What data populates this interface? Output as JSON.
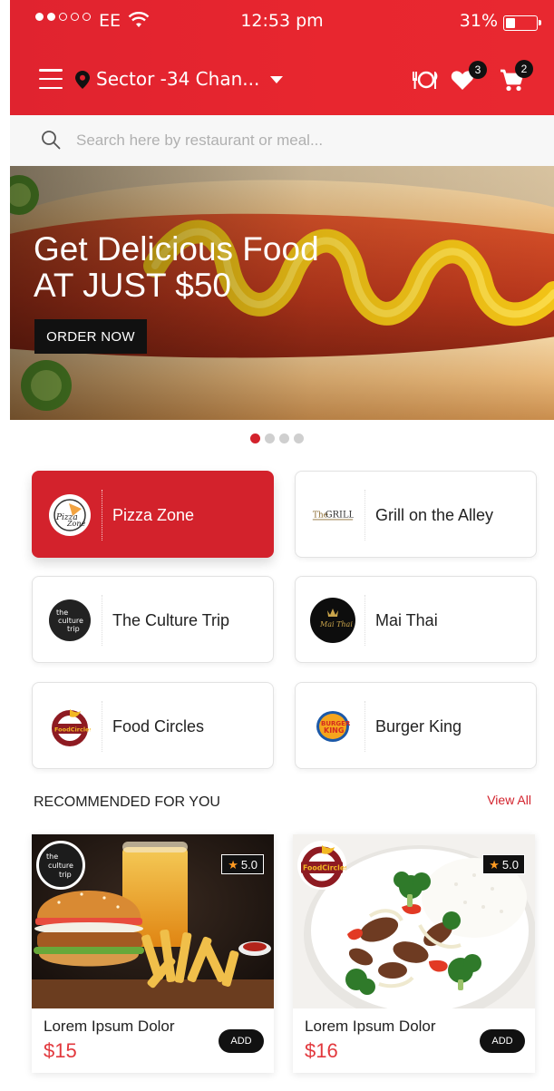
{
  "status_bar": {
    "carrier": "EE",
    "time": "12:53 pm",
    "battery_pct": "31%",
    "battery_level": 0.31,
    "signal_bars_filled": 2,
    "signal_bars_total": 5
  },
  "header": {
    "location": "Sector -34 Chan...",
    "favorites_count": "3",
    "cart_count": "2",
    "color": "#e3242f"
  },
  "search": {
    "placeholder": "Search here by restaurant or meal..."
  },
  "banner": {
    "title": "Get Delicious Food",
    "subtitle": "AT JUST $50",
    "button": "ORDER NOW",
    "slides": 4,
    "active_slide": 1
  },
  "restaurants": [
    {
      "name": "Pizza Zone",
      "logo_text": "Pizza Zone",
      "selected": true
    },
    {
      "name": "Grill on the Alley",
      "logo_text": "The GRILL",
      "selected": false
    },
    {
      "name": "The Culture Trip",
      "logo_text": "the culture trip",
      "selected": false
    },
    {
      "name": "Mai Thai",
      "logo_text": "Mai Thai",
      "selected": false
    },
    {
      "name": "Food Circles",
      "logo_text": "FoodCircles",
      "selected": false
    },
    {
      "name": "Burger King",
      "logo_text": "BURGER KING",
      "selected": false
    }
  ],
  "recommended": {
    "title": "RECOMMENDED FOR YOU",
    "view_all": "View All",
    "items": [
      {
        "name": "Lorem Ipsum Dolor",
        "price": "$15",
        "rating": "5.0",
        "add_label": "ADD",
        "restaurant_logo": "the culture trip"
      },
      {
        "name": "Lorem Ipsum Dolor",
        "price": "$16",
        "rating": "5.0",
        "add_label": "ADD",
        "restaurant_logo": "FoodCircles"
      }
    ]
  },
  "colors": {
    "accent": "#d3222c",
    "price": "#e2383d",
    "star": "#ff9b22"
  }
}
